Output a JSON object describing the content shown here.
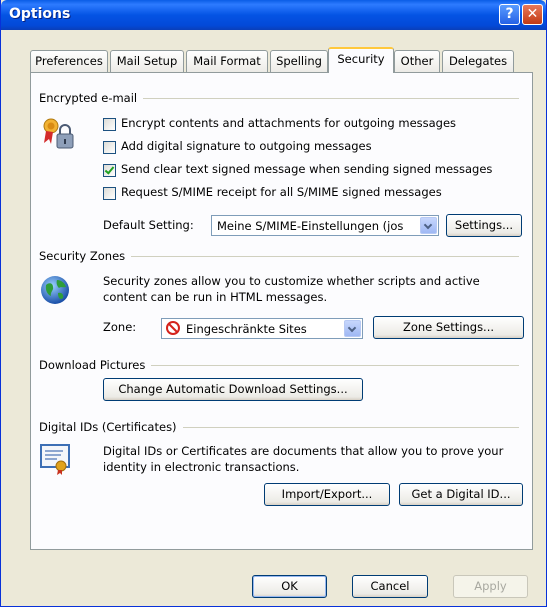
{
  "window": {
    "title": "Options",
    "help_glyph": "?",
    "close_glyph": "✕"
  },
  "tabs": [
    {
      "label": "Preferences"
    },
    {
      "label": "Mail Setup"
    },
    {
      "label": "Mail Format"
    },
    {
      "label": "Spelling"
    },
    {
      "label": "Security"
    },
    {
      "label": "Other"
    },
    {
      "label": "Delegates"
    }
  ],
  "active_tab": "Security",
  "encrypted_email": {
    "heading": "Encrypted e-mail",
    "options": [
      {
        "label": "Encrypt contents and attachments for outgoing messages",
        "checked": false
      },
      {
        "label": "Add digital signature to outgoing messages",
        "checked": false
      },
      {
        "label": "Send clear text signed message when sending signed messages",
        "checked": true
      },
      {
        "label": "Request S/MIME receipt for all S/MIME signed messages",
        "checked": false
      }
    ],
    "default_setting_label": "Default Setting:",
    "default_setting_value": "Meine S/MIME-Einstellungen (jos",
    "settings_button": "Settings..."
  },
  "security_zones": {
    "heading": "Security Zones",
    "description_line1": "Security zones allow you to customize whether scripts and active",
    "description_line2": "content can be run in HTML messages.",
    "zone_label": "Zone:",
    "zone_value": "Eingeschränkte Sites",
    "zone_settings_button": "Zone Settings..."
  },
  "download_pictures": {
    "heading": "Download Pictures",
    "button": "Change Automatic Download Settings..."
  },
  "digital_ids": {
    "heading": "Digital IDs (Certificates)",
    "description_line1": "Digital IDs or Certificates are documents that allow you to prove your",
    "description_line2": "identity in electronic transactions.",
    "import_export_button": "Import/Export...",
    "get_digital_id_button": "Get a Digital ID..."
  },
  "footer": {
    "ok": "OK",
    "cancel": "Cancel",
    "apply": "Apply"
  },
  "colors": {
    "titlebar": "#0A5DE6",
    "face": "#ECE9D8",
    "panel": "#FCFCFE",
    "active_tab_accent": "#FFC83C"
  }
}
